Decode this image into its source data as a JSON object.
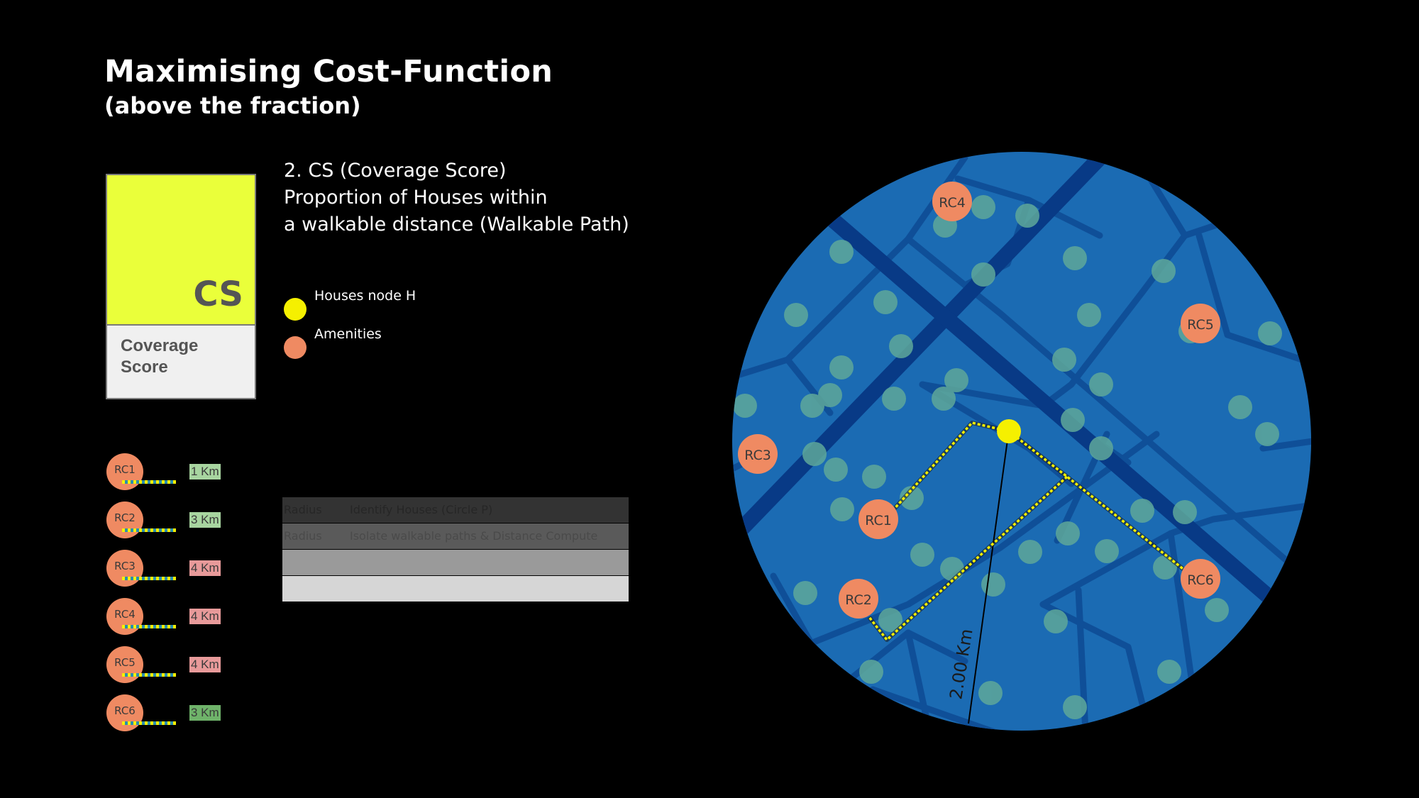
{
  "header": {
    "title": "Maximising Cost-Function",
    "subtitle": "(above the fraction)"
  },
  "score_card": {
    "abbr": "CS",
    "label": "Coverage Score",
    "top_color": "#eaff3a",
    "bottom_color": "#f0f0f0"
  },
  "description": {
    "line1": "2. CS  (Coverage Score)",
    "line2": "Proportion of Houses within",
    "line3": "a walkable distance (Walkable Path)"
  },
  "legend": [
    {
      "label": "Houses node H",
      "color": "#f5f000"
    },
    {
      "label": "Amenities",
      "color": "#ef8a62"
    }
  ],
  "amenities": [
    {
      "id": "RC1",
      "distance": "1 Km",
      "badge_color": "#a8d5a0"
    },
    {
      "id": "RC2",
      "distance": "3 Km",
      "badge_color": "#a8d5a0"
    },
    {
      "id": "RC3",
      "distance": "4 Km",
      "badge_color": "#e89a9a"
    },
    {
      "id": "RC4",
      "distance": "4 Km",
      "badge_color": "#e89a9a"
    },
    {
      "id": "RC5",
      "distance": "4 Km",
      "badge_color": "#e89a9a"
    },
    {
      "id": "RC6",
      "distance": "3 Km",
      "badge_color": "#6fb36a"
    }
  ],
  "faded_table": {
    "rows": [
      {
        "a": "Radius",
        "b": "Identify Houses (Circle P)",
        "bg": "#333333",
        "fg": "#262626"
      },
      {
        "a": "Radius",
        "b": "Isolate walkable paths & Distance Compute",
        "bg": "#5a5a5a",
        "fg": "#4a4a4a"
      },
      {
        "a": "",
        "b": "",
        "bg": "#9a9a9a",
        "fg": "#8a8a8a"
      },
      {
        "a": "",
        "b": "",
        "bg": "#d6d6d6",
        "fg": "#c0c0c0"
      }
    ]
  },
  "map": {
    "radius_label": "2.00 Km",
    "colors": {
      "water": "#1b6bb3",
      "road_minor": "#0f4f98",
      "road_major": "#083a86",
      "house": "#5ea89a",
      "amenity": "#ef8a62",
      "origin": "#f5f000"
    }
  }
}
